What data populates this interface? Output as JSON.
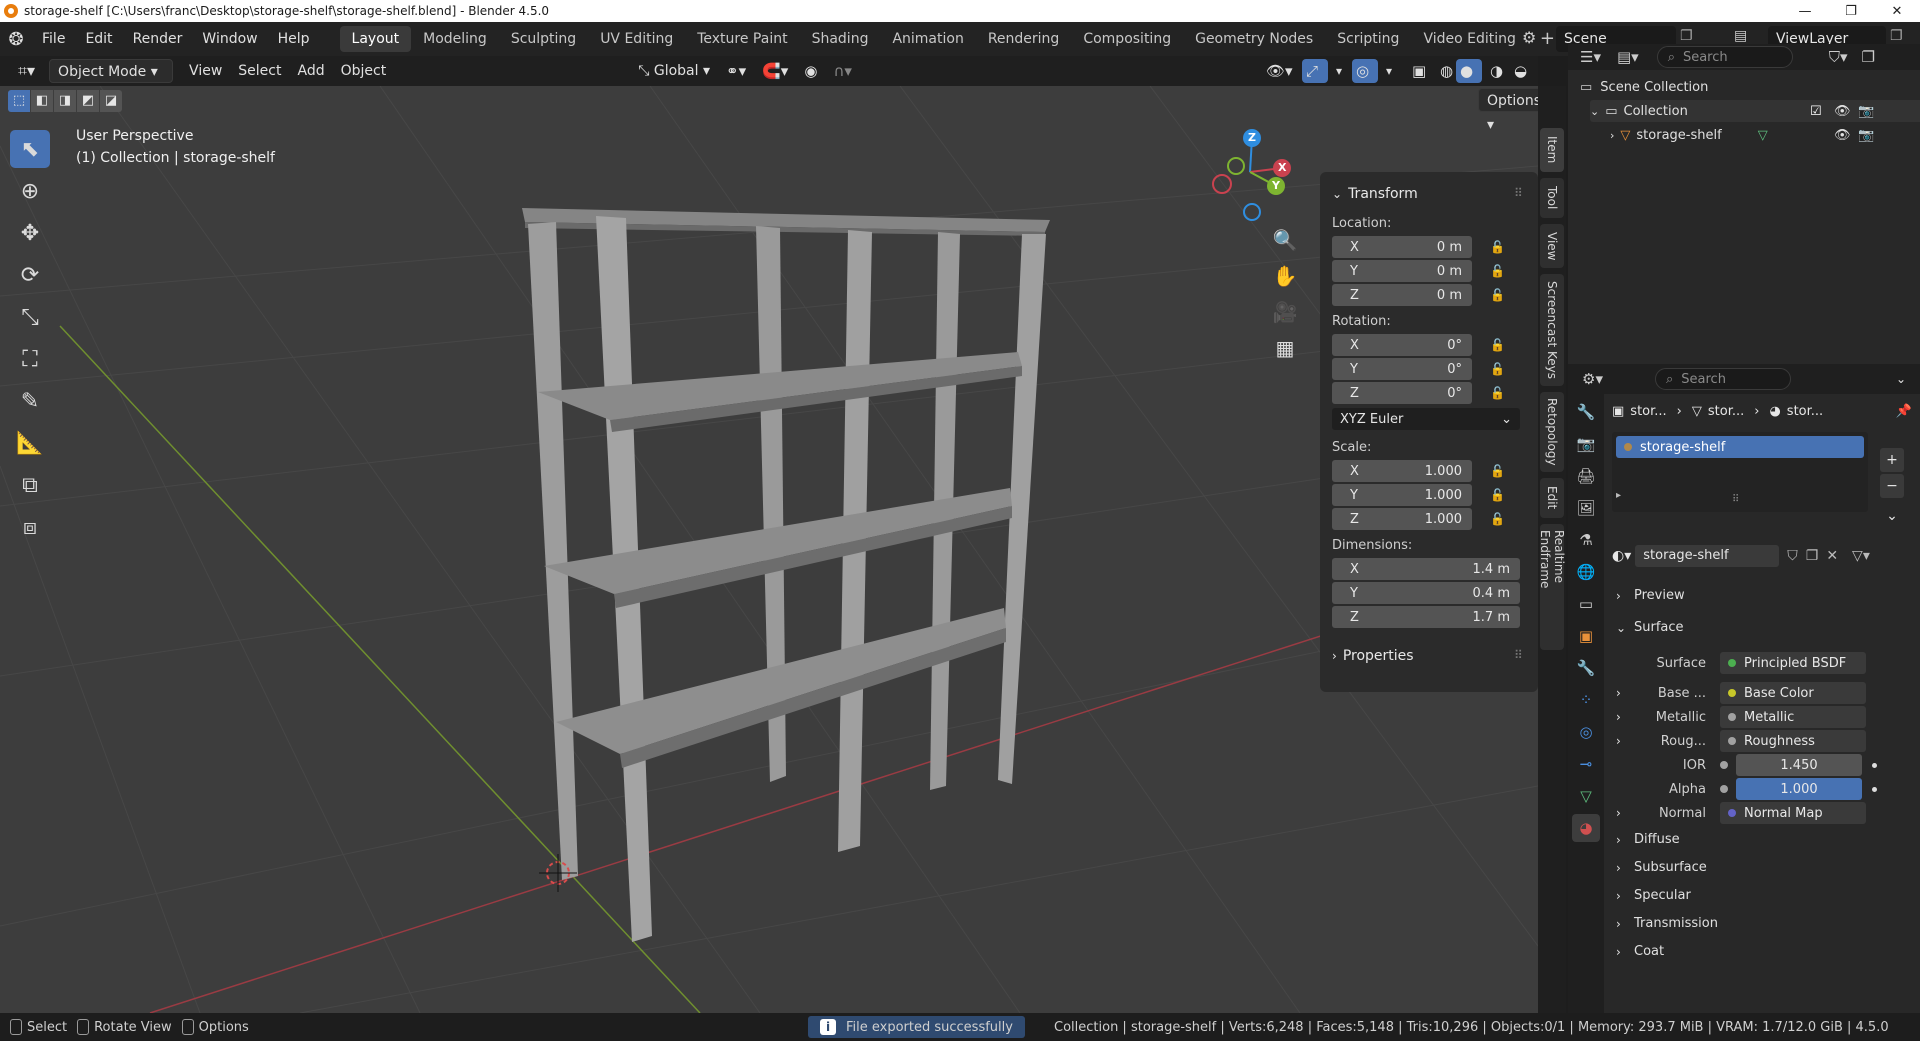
{
  "window": {
    "title": "storage-shelf [C:\\Users\\franc\\Desktop\\storage-shelf\\storage-shelf.blend] - Blender 4.5.0"
  },
  "menus": [
    "File",
    "Edit",
    "Render",
    "Window",
    "Help"
  ],
  "workspaces": [
    "Layout",
    "Modeling",
    "Sculpting",
    "UV Editing",
    "Texture Paint",
    "Shading",
    "Animation",
    "Rendering",
    "Compositing",
    "Geometry Nodes",
    "Scripting",
    "Video Editing"
  ],
  "active_workspace": "Layout",
  "scene": {
    "name": "Scene",
    "view_layer": "ViewLayer"
  },
  "viewport_header": {
    "mode": "Object Mode",
    "menus": [
      "View",
      "Select",
      "Add",
      "Object"
    ],
    "transform_orientation": "Global",
    "options_label": "Options"
  },
  "viewport": {
    "perspective_label": "User Perspective",
    "collection_label": "(1) Collection | storage-shelf",
    "gizmo": {
      "x": "X",
      "y": "Y",
      "z": "Z"
    }
  },
  "npanel": {
    "transform_title": "Transform",
    "location_label": "Location:",
    "location": {
      "x": "0 m",
      "y": "0 m",
      "z": "0 m"
    },
    "rotation_label": "Rotation:",
    "rotation": {
      "x": "0°",
      "y": "0°",
      "z": "0°"
    },
    "rotation_mode": "XYZ Euler",
    "scale_label": "Scale:",
    "scale": {
      "x": "1.000",
      "y": "1.000",
      "z": "1.000"
    },
    "dimensions_label": "Dimensions:",
    "dimensions": {
      "x": "1.4 m",
      "y": "0.4 m",
      "z": "1.7 m"
    },
    "properties_title": "Properties",
    "axis_labels": {
      "x": "X",
      "y": "Y",
      "z": "Z"
    }
  },
  "sidebar_tabs": [
    "Item",
    "Tool",
    "View",
    "Screencast Keys",
    "Retopology",
    "Edit",
    "Realtime Endframe"
  ],
  "outliner": {
    "search_placeholder": "Search",
    "scene_collection": "Scene Collection",
    "collection": "Collection",
    "object": "storage-shelf"
  },
  "properties": {
    "search_placeholder": "Search",
    "breadcrumb": [
      "stor...",
      "stor...",
      "stor..."
    ],
    "material_slot": "storage-shelf",
    "material_name": "storage-shelf",
    "sections": {
      "preview": "Preview",
      "surface": "Surface",
      "diffuse": "Diffuse",
      "subsurface": "Subsurface",
      "specular": "Specular",
      "transmission": "Transmission",
      "coat": "Coat"
    },
    "surface_rows": [
      {
        "label": "Surface",
        "value": "Principled BSDF",
        "dot": "#4caf50"
      },
      {
        "label": "Base ...",
        "value": "Base Color",
        "dot": "#c7c729"
      },
      {
        "label": "Metallic",
        "value": "Metallic",
        "dot": "#a1a1a1"
      },
      {
        "label": "Roug...",
        "value": "Roughness",
        "dot": "#a1a1a1"
      },
      {
        "label": "IOR",
        "value": "1.450",
        "dot": "#a1a1a1"
      },
      {
        "label": "Alpha",
        "value": "1.000",
        "dot": "#a1a1a1"
      },
      {
        "label": "Normal",
        "value": "Normal Map",
        "dot": "#6363c7"
      }
    ]
  },
  "statusbar": {
    "select": "Select",
    "rotate": "Rotate View",
    "options": "Options",
    "message": "File exported successfully",
    "stats": "Collection | storage-shelf | Verts:6,248 | Faces:5,148 | Tris:10,296 | Objects:0/1 | Memory: 293.7 MiB | VRAM: 1.7/12.0 GiB | 4.5.0"
  },
  "colors": {
    "accent": "#4772b3",
    "viewport_bg": "#3d3d3d",
    "panel_bg": "#2b2b2b",
    "header_bg": "#232323",
    "x_axis": "#c9424f",
    "y_axis": "#7eb431",
    "z_axis": "#2f8ee0"
  }
}
